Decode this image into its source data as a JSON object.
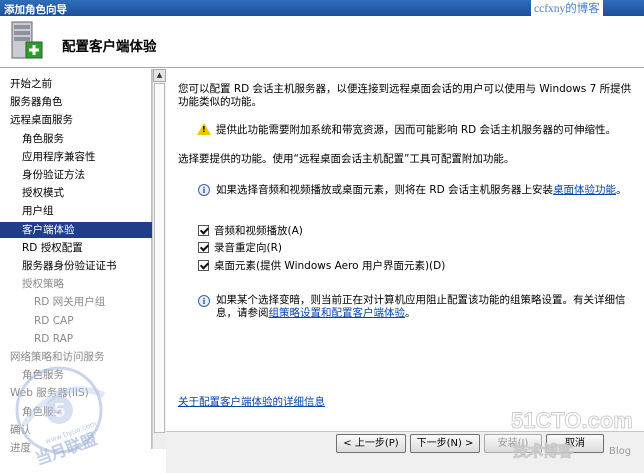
{
  "window": {
    "title": "添加角色向导",
    "watermark_text": "ccfxny的博客"
  },
  "header": {
    "title": "配置客户端体验"
  },
  "nav": {
    "items": [
      {
        "label": "开始之前",
        "level": 0,
        "state": "normal"
      },
      {
        "label": "服务器角色",
        "level": 0,
        "state": "normal"
      },
      {
        "label": "远程桌面服务",
        "level": 0,
        "state": "normal"
      },
      {
        "label": "角色服务",
        "level": 1,
        "state": "normal"
      },
      {
        "label": "应用程序兼容性",
        "level": 1,
        "state": "normal"
      },
      {
        "label": "身份验证方法",
        "level": 1,
        "state": "normal"
      },
      {
        "label": "授权模式",
        "level": 1,
        "state": "normal"
      },
      {
        "label": "用户组",
        "level": 1,
        "state": "normal"
      },
      {
        "label": "客户端体验",
        "level": 1,
        "state": "selected"
      },
      {
        "label": "RD 授权配置",
        "level": 1,
        "state": "normal"
      },
      {
        "label": "服务器身份验证证书",
        "level": 1,
        "state": "normal"
      },
      {
        "label": "授权策略",
        "level": 1,
        "state": "disabled"
      },
      {
        "label": "RD 网关用户组",
        "level": 2,
        "state": "disabled"
      },
      {
        "label": "RD CAP",
        "level": 2,
        "state": "disabled"
      },
      {
        "label": "RD RAP",
        "level": 2,
        "state": "disabled"
      },
      {
        "label": "网络策略和访问服务",
        "level": 0,
        "state": "disabled"
      },
      {
        "label": "角色服务",
        "level": 1,
        "state": "disabled"
      },
      {
        "label": "Web 服务器(IIS)",
        "level": 0,
        "state": "disabled"
      },
      {
        "label": "角色服务",
        "level": 1,
        "state": "disabled"
      },
      {
        "label": "确认",
        "level": 0,
        "state": "disabled"
      },
      {
        "label": "进度",
        "level": 0,
        "state": "disabled"
      }
    ]
  },
  "content": {
    "intro": "您可以配置 RD 会话主机服务器，以便连接到远程桌面会话的用户可以使用与 Windows 7 所提供功能类似的功能。",
    "warning": "提供此功能需要附加系统和带宽资源，因而可能影响 RD 会话主机服务器的可伸缩性。",
    "select_prompt": "选择要提供的功能。使用“远程桌面会话主机配置”工具可配置附加功能。",
    "info1_prefix": "如果选择音频和视频播放或桌面元素，则将在 RD 会话主机服务器上安装",
    "info1_link": "桌面体验功能",
    "info1_suffix": "。",
    "checkboxes": [
      {
        "label": "音频和视频播放(A)",
        "checked": true
      },
      {
        "label": "录音重定向(R)",
        "checked": true
      },
      {
        "label": "桌面元素(提供 Windows Aero 用户界面元素)(D)",
        "checked": true
      }
    ],
    "info2_prefix": "如果某个选择变暗，则当前正在对计算机应用阻止配置该功能的组策略设置。有关详细信息，请参阅",
    "info2_link": "组策略设置和配置客户端体验",
    "info2_suffix": "。",
    "more_link": "关于配置客户端体验的详细信息"
  },
  "buttons": {
    "back": "< 上一步(P)",
    "next": "下一步(N) >",
    "install": "安装(I)",
    "cancel": "取消"
  },
  "overlay": {
    "site_watermark": "51CTO.com",
    "site_sub": "技术博客",
    "blog": "Blog",
    "stamp": "当月联盟",
    "stamp_url": "www.Dyuo.com"
  }
}
